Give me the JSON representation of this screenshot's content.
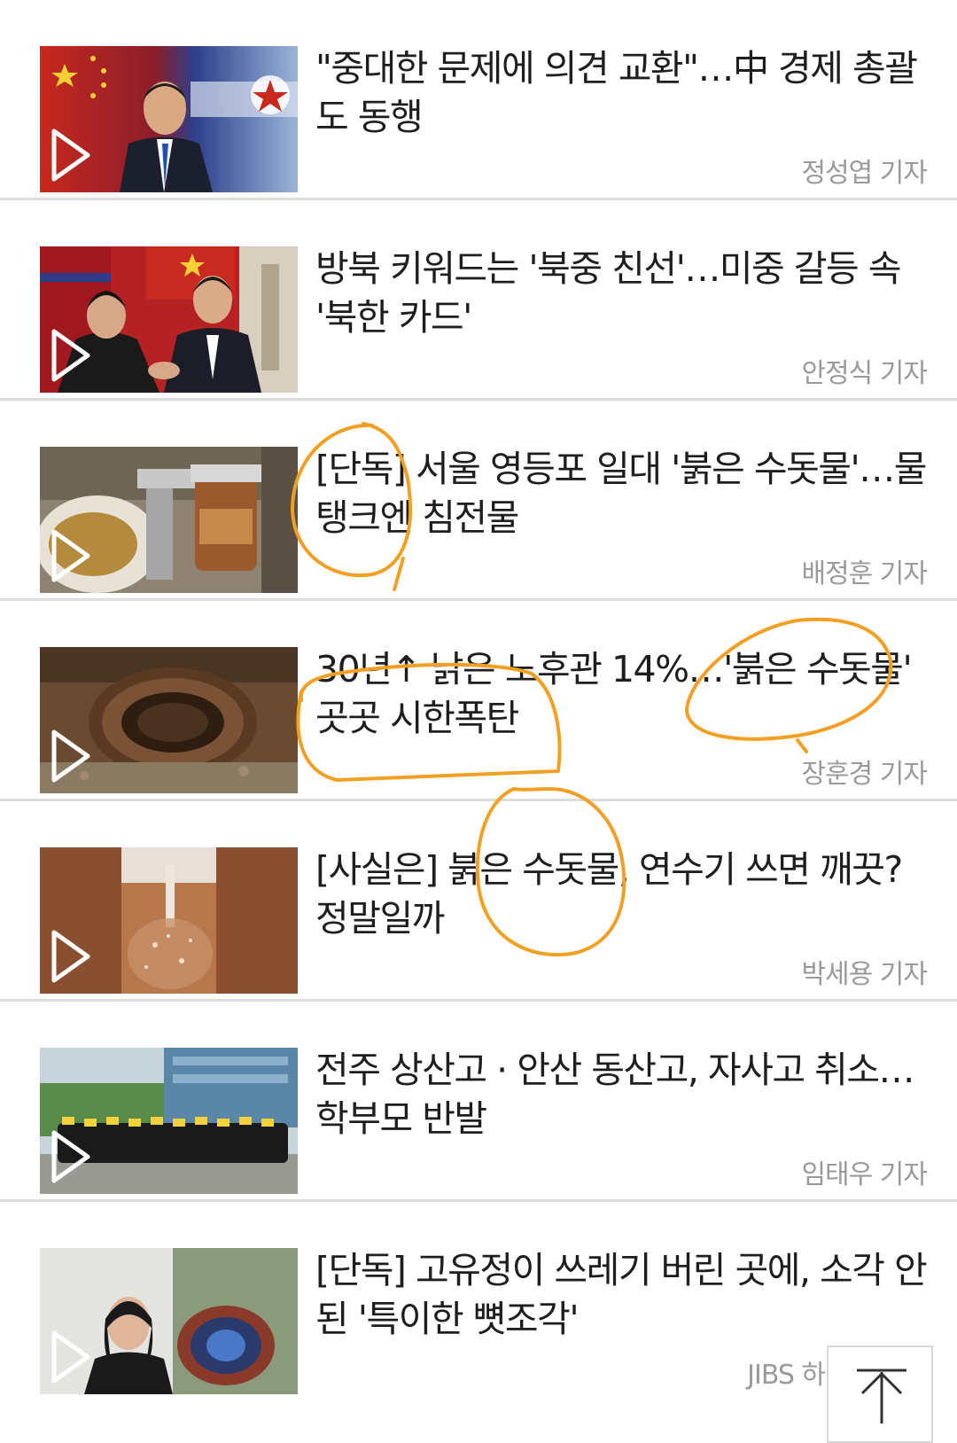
{
  "articles": [
    {
      "headline": "\"중대한 문제에 의견 교환\"…中 경제 총괄 도 동행",
      "reporter": "정성엽 기자",
      "thumbnail": "xi-jinping-flags"
    },
    {
      "headline": "방북 키워드는 '북중 친선'…미중 갈등 속 '북한 카드'",
      "reporter": "안정식 기자",
      "thumbnail": "kim-xi-handshake"
    },
    {
      "headline": "[단독] 서울 영등포 일대 '붉은 수돗물'…물 탱크엔 침전물",
      "reporter": "배정훈 기자",
      "thumbnail": "faucet-filter"
    },
    {
      "headline": "30년↑ 낡은 노후관 14%…'붉은 수돗물' 곳곳 시한폭탄",
      "reporter": "장훈경 기자",
      "thumbnail": "rusty-pipe"
    },
    {
      "headline": "[사실은] 붉은 수돗물, 연수기 쓰면 깨끗? 정말일까",
      "reporter": "박세용 기자",
      "thumbnail": "tap-water-stream"
    },
    {
      "headline": "전주 상산고 · 안산 동산고, 자사고 취소… 학부모 반발",
      "reporter": "임태우 기자",
      "thumbnail": "parents-protest"
    },
    {
      "headline": "[단독] 고유정이 쓰레기 버린 곳에, 소각 안 된 '특이한 뼛조각'",
      "reporter": "JIBS 하창훈 기자",
      "thumbnail": "woman-and-pipe"
    }
  ],
  "colors": {
    "annotation": "#f2a024",
    "divider": "#dcdcdc",
    "reporter": "#9a9a9a"
  },
  "scroll_top_icon": "arrow-up-icon"
}
